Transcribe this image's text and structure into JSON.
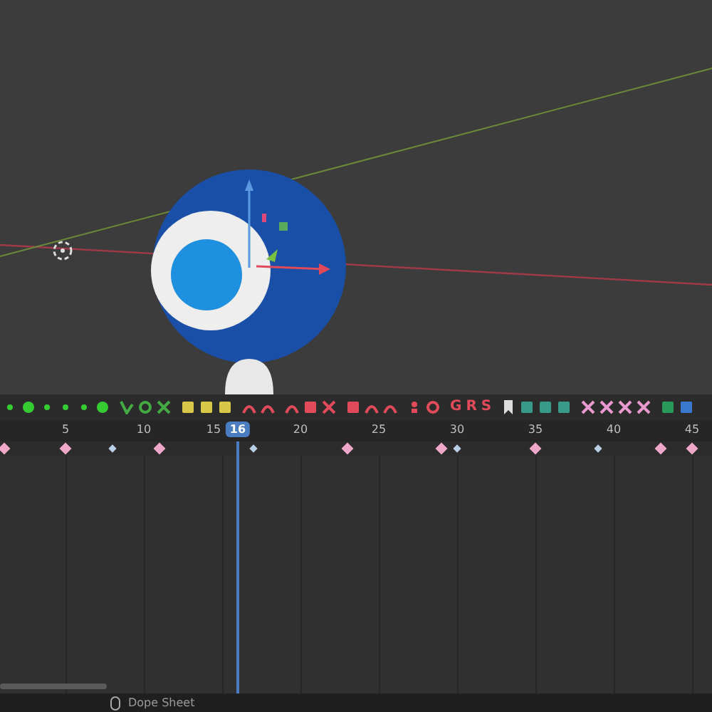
{
  "toolbar": {
    "transform_buttons": [
      "G",
      "R",
      "S"
    ]
  },
  "timeline": {
    "frame_labels": [
      "5",
      "10",
      "15",
      "20",
      "25",
      "30",
      "35",
      "40",
      "45"
    ],
    "current_frame": "16",
    "keyframes": [
      {
        "kind": "key"
      },
      {
        "kind": "key"
      },
      {
        "kind": "small"
      },
      {
        "kind": "key"
      },
      {
        "kind": "small"
      },
      {
        "kind": "key"
      },
      {
        "kind": "key"
      },
      {
        "kind": "small"
      },
      {
        "kind": "key"
      },
      {
        "kind": "small"
      },
      {
        "kind": "key"
      },
      {
        "kind": "key"
      }
    ]
  },
  "status_bar": {
    "editor": "Dope Sheet"
  }
}
